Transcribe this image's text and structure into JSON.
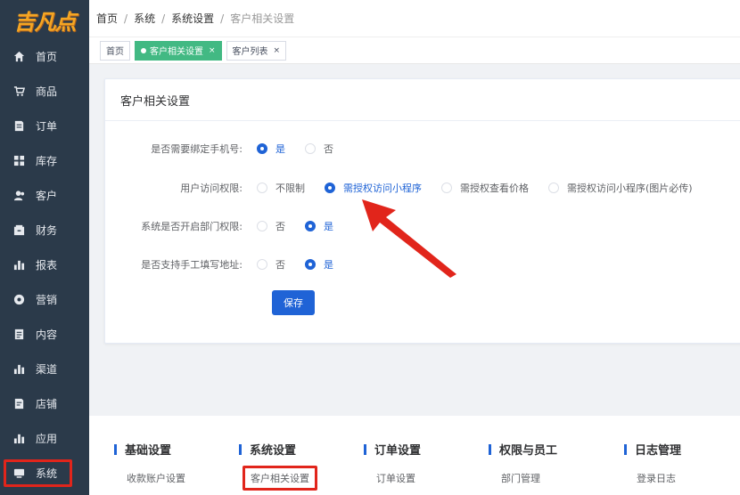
{
  "logo": {
    "text": "吉凡点"
  },
  "sidebar": {
    "items": [
      {
        "label": "首页",
        "icon": "home-icon"
      },
      {
        "label": "商品",
        "icon": "cart-icon"
      },
      {
        "label": "订单",
        "icon": "order-icon"
      },
      {
        "label": "库存",
        "icon": "grid-icon"
      },
      {
        "label": "客户",
        "icon": "user-icon"
      },
      {
        "label": "财务",
        "icon": "wallet-icon"
      },
      {
        "label": "报表",
        "icon": "bar-chart-icon"
      },
      {
        "label": "营销",
        "icon": "gear-icon"
      },
      {
        "label": "内容",
        "icon": "document-icon"
      },
      {
        "label": "渠道",
        "icon": "bar-chart-icon"
      },
      {
        "label": "店铺",
        "icon": "store-icon"
      },
      {
        "label": "应用",
        "icon": "bar-chart-icon"
      },
      {
        "label": "系统",
        "icon": "monitor-icon"
      }
    ],
    "active_index": 12
  },
  "breadcrumb": {
    "items": [
      "首页",
      "系统",
      "系统设置",
      "客户相关设置"
    ],
    "separator": "/"
  },
  "tabs": [
    {
      "label": "首页",
      "active": false,
      "closable": false
    },
    {
      "label": "客户相关设置",
      "active": true,
      "closable": true
    },
    {
      "label": "客户列表",
      "active": false,
      "closable": true
    }
  ],
  "tab_close_glyph": "×",
  "card": {
    "title": "客户相关设置",
    "rows": [
      {
        "label": "是否需要绑定手机号:",
        "options": [
          "是",
          "否"
        ],
        "selected": 0
      },
      {
        "label": "用户访问权限:",
        "options": [
          "不限制",
          "需授权访问小程序",
          "需授权查看价格",
          "需授权访问小程序(图片必传)"
        ],
        "selected": 1
      },
      {
        "label": "系统是否开启部门权限:",
        "options": [
          "否",
          "是"
        ],
        "selected": 1
      },
      {
        "label": "是否支持手工填写地址:",
        "options": [
          "否",
          "是"
        ],
        "selected": 1
      }
    ],
    "save_label": "保存"
  },
  "bottom_nav": {
    "columns": [
      {
        "title": "基础设置",
        "link": "收款账户设置"
      },
      {
        "title": "系统设置",
        "link": "客户相关设置"
      },
      {
        "title": "订单设置",
        "link": "订单设置"
      },
      {
        "title": "权限与员工",
        "link": "部门管理"
      },
      {
        "title": "日志管理",
        "link": "登录日志"
      }
    ]
  },
  "colors": {
    "sidebar_bg": "#2b3a4a",
    "primary": "#1f63d6",
    "tag_active": "#42b983",
    "annotation_red": "#e1251b"
  }
}
